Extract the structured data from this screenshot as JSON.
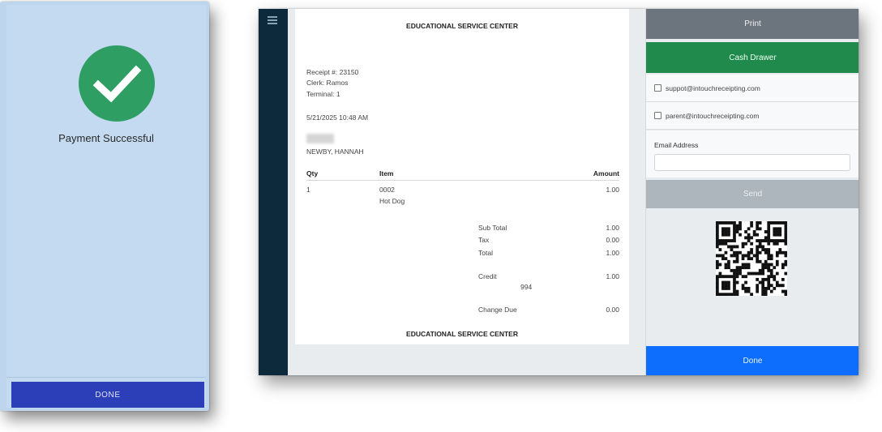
{
  "phone": {
    "message": "Payment Successful",
    "done_label": "DONE",
    "check_icon": "check-circle-icon",
    "colors": {
      "background": "#c3daf1",
      "success": "#2e9e63",
      "button": "#2c3fb8"
    }
  },
  "tablet": {
    "menu_icon": "hamburger-menu-icon",
    "receipt": {
      "title": "EDUCATIONAL SERVICE CENTER",
      "receipt_no": "Receipt #: 23150",
      "clerk": "Clerk: Ramos",
      "terminal": "Terminal: 1",
      "datetime": "5/21/2025 10:48 AM",
      "customer": "NEWBY, HANNAH",
      "headers": {
        "qty": "Qty",
        "item": "Item",
        "amount": "Amount"
      },
      "line_items": [
        {
          "qty": "1",
          "code": "0002",
          "name": "Hot Dog",
          "amount": "1.00"
        }
      ],
      "totals": {
        "subtotal_label": "Sub Total",
        "subtotal": "1.00",
        "tax_label": "Tax",
        "tax": "0.00",
        "total_label": "Total",
        "total": "1.00",
        "credit_label": "Credit",
        "credit": "1.00",
        "credit_ref": "994",
        "change_label": "Change Due",
        "change": "0.00"
      },
      "footer": "EDUCATIONAL SERVICE CENTER"
    },
    "actions": {
      "print_label": "Print",
      "cash_drawer_label": "Cash Drawer",
      "email_options": [
        "suppot@intouchreceipting.com",
        "parent@intouchreceipting.com"
      ],
      "email_label": "Email Address",
      "email_value": "",
      "send_label": "Send",
      "qr_icon": "qr-code-icon",
      "done_label": "Done"
    },
    "colors": {
      "rail": "#0d2a3d",
      "print": "#6c757d",
      "cash_drawer": "#1f8a4c",
      "send": "#adb5bd",
      "done": "#0d6efd"
    }
  }
}
